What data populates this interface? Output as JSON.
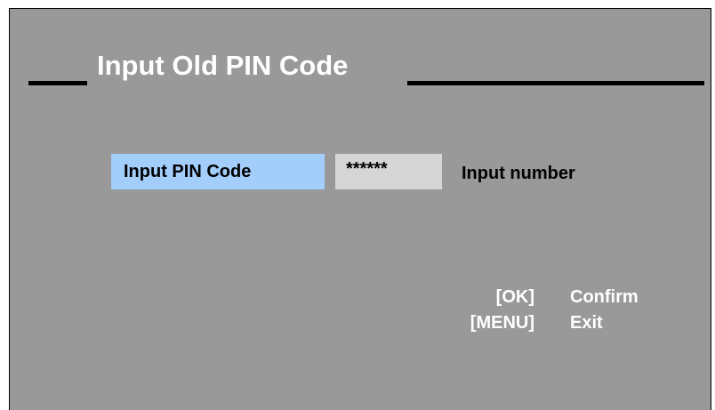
{
  "dialog": {
    "title": "Input Old PIN Code"
  },
  "pin": {
    "label": "Input PIN Code",
    "value": "******",
    "hint": "Input number"
  },
  "keys": [
    {
      "key": "[OK]",
      "action": "Confirm"
    },
    {
      "key": "[MENU]",
      "action": "Exit"
    }
  ],
  "colors": {
    "background": "#999999",
    "label_highlight": "#a3cdfb",
    "field_background": "#d6d6d6",
    "title_text": "#ffffff"
  }
}
